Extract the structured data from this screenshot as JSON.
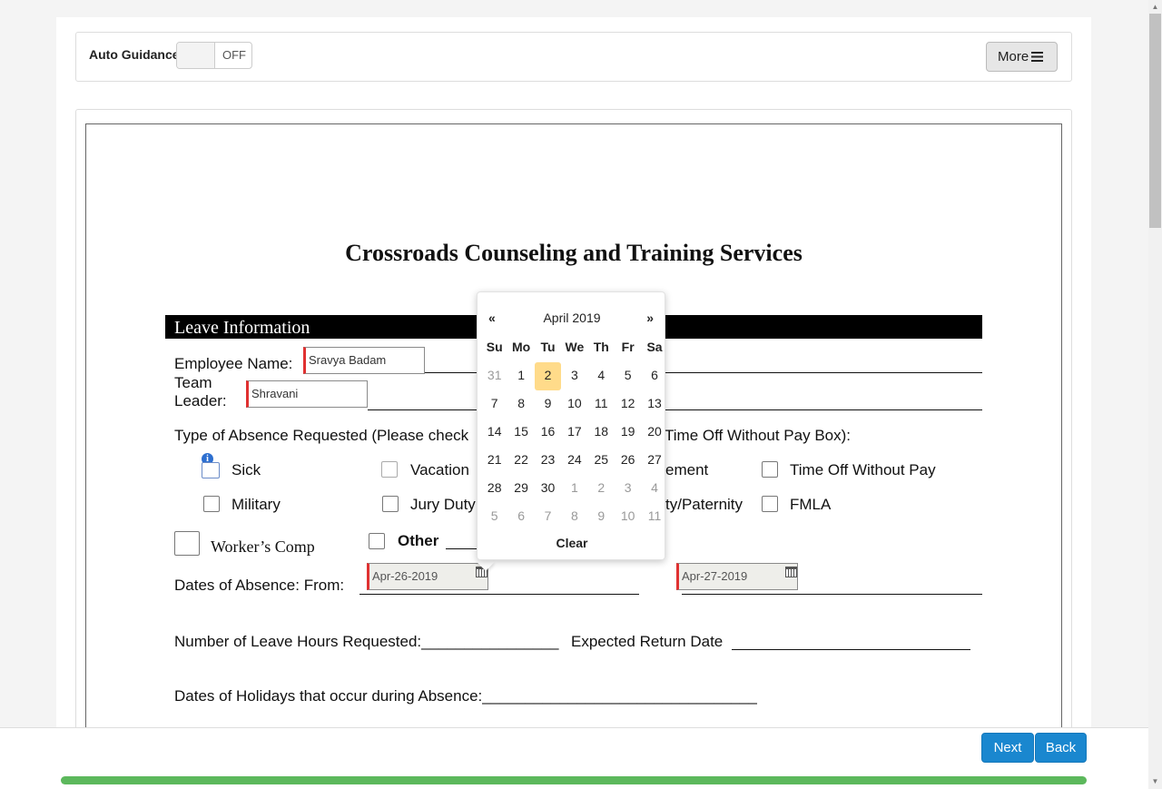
{
  "toolbar": {
    "auto_guidance_label": "Auto Guidance",
    "toggle_state": "OFF",
    "more_label": "More"
  },
  "document": {
    "title": "Crossroads Counseling and Training Services",
    "section_header": "Leave Information",
    "employee_name_label": "Employee Name:",
    "employee_name_value": "Sravya Badam",
    "team_leader_label_1": "Team",
    "team_leader_label_2": "Leader:",
    "team_leader_value": "Shravani",
    "absence_type_left": "Type of Absence Requested (Please check",
    "absence_type_right": "Time Off Without Pay Box):",
    "options": {
      "sick": "Sick",
      "vacation": "Vacation",
      "bereavement_partial": "ement",
      "time_off_without_pay": "Time Off Without Pay",
      "military": "Military",
      "jury_duty": "Jury Duty",
      "maternity_paternity_partial": "ty/Paternity",
      "fmla": "FMLA",
      "workers_comp": "Worker’s Comp",
      "other": "Other"
    },
    "dates_of_absence_label": "Dates of Absence: From:",
    "date_from_value": "Apr-26-2019",
    "date_to_value": "Apr-27-2019",
    "leave_hours_label": "Number of Leave Hours Requested:________________",
    "expected_return_label": "Expected Return Date",
    "holidays_label": "Dates of Holidays that occur during Absence:________________________________"
  },
  "datepicker": {
    "prev": "«",
    "next": "»",
    "month_year": "April 2019",
    "weekdays": [
      "Su",
      "Mo",
      "Tu",
      "We",
      "Th",
      "Fr",
      "Sa"
    ],
    "weeks": [
      [
        "31",
        "1",
        "2",
        "3",
        "4",
        "5",
        "6"
      ],
      [
        "7",
        "8",
        "9",
        "10",
        "11",
        "12",
        "13"
      ],
      [
        "14",
        "15",
        "16",
        "17",
        "18",
        "19",
        "20"
      ],
      [
        "21",
        "22",
        "23",
        "24",
        "25",
        "26",
        "27"
      ],
      [
        "28",
        "29",
        "30",
        "1",
        "2",
        "3",
        "4"
      ],
      [
        "5",
        "6",
        "7",
        "8",
        "9",
        "10",
        "11"
      ]
    ],
    "today": "2",
    "clear_label": "Clear"
  },
  "footer": {
    "next_label": "Next",
    "back_label": "Back",
    "progress_fraction": 1.0
  },
  "colors": {
    "primary_button": "#1a87cf",
    "progress": "#5cb85c",
    "required_marker": "#e03131",
    "today_highlight": "#ffdb8a"
  }
}
